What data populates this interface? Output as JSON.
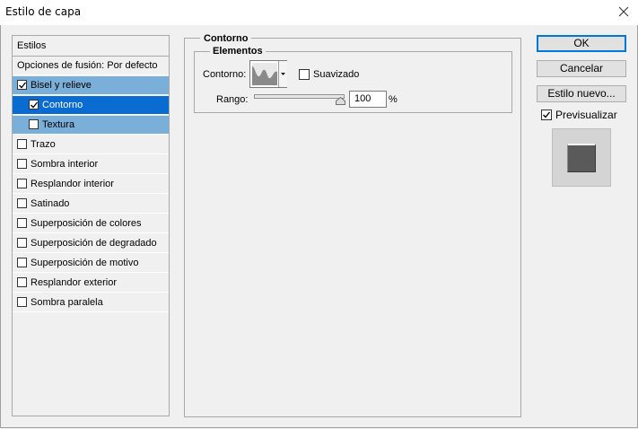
{
  "window": {
    "title": "Estilo de capa"
  },
  "styles_panel": {
    "header": "Estilos",
    "blending_options": "Opciones de fusión: Por defecto",
    "items": [
      {
        "label": "Bisel y relieve",
        "checked": true,
        "state": "highlighted"
      },
      {
        "label": "Contorno",
        "checked": true,
        "state": "selected"
      },
      {
        "label": "Textura",
        "checked": false,
        "state": "highlighted"
      },
      {
        "label": "Trazo",
        "checked": false,
        "state": "normal"
      },
      {
        "label": "Sombra interior",
        "checked": false,
        "state": "normal"
      },
      {
        "label": "Resplandor interior",
        "checked": false,
        "state": "normal"
      },
      {
        "label": "Satinado",
        "checked": false,
        "state": "normal"
      },
      {
        "label": "Superposición de colores",
        "checked": false,
        "state": "normal"
      },
      {
        "label": "Superposición de degradado",
        "checked": false,
        "state": "normal"
      },
      {
        "label": "Superposición de motivo",
        "checked": false,
        "state": "normal"
      },
      {
        "label": "Resplandor exterior",
        "checked": false,
        "state": "normal"
      },
      {
        "label": "Sombra paralela",
        "checked": false,
        "state": "normal"
      }
    ]
  },
  "contour_section": {
    "title": "Contorno",
    "group_title": "Elementos",
    "contour_label": "Contorno:",
    "smooth_label": "Suavizado",
    "smooth_checked": false,
    "range_label": "Rango:",
    "range_value": "100",
    "range_unit": "%"
  },
  "buttons": {
    "ok": "OK",
    "cancel": "Cancelar",
    "new_style": "Estilo nuevo..."
  },
  "preview": {
    "label": "Previsualizar",
    "checked": true
  },
  "colors": {
    "selected_row": "#0a6bd0",
    "highlighted_row": "#7aafd9",
    "ok_border": "#0078d7"
  }
}
